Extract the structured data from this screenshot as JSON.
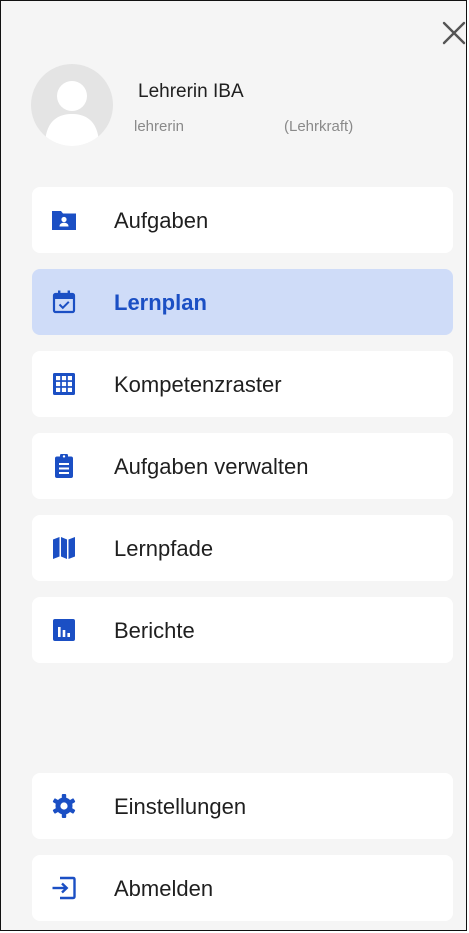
{
  "user": {
    "name": "Lehrerin IBA",
    "login": "lehrerin",
    "role": "(Lehrkraft)"
  },
  "accent_color": "#1b4fc4",
  "active_item_background": "#cfdcf8",
  "nav": {
    "items": [
      {
        "label": "Aufgaben",
        "icon": "folder-user-icon",
        "active": false
      },
      {
        "label": "Lernplan",
        "icon": "calendar-check-icon",
        "active": true
      },
      {
        "label": "Kompetenzraster",
        "icon": "grid-icon",
        "active": false
      },
      {
        "label": "Aufgaben verwalten",
        "icon": "clipboard-list-icon",
        "active": false
      },
      {
        "label": "Lernpfade",
        "icon": "map-icon",
        "active": false
      },
      {
        "label": "Berichte",
        "icon": "bar-chart-icon",
        "active": false
      }
    ],
    "bottom_items": [
      {
        "label": "Einstellungen",
        "icon": "gear-icon"
      },
      {
        "label": "Abmelden",
        "icon": "logout-icon"
      }
    ]
  }
}
